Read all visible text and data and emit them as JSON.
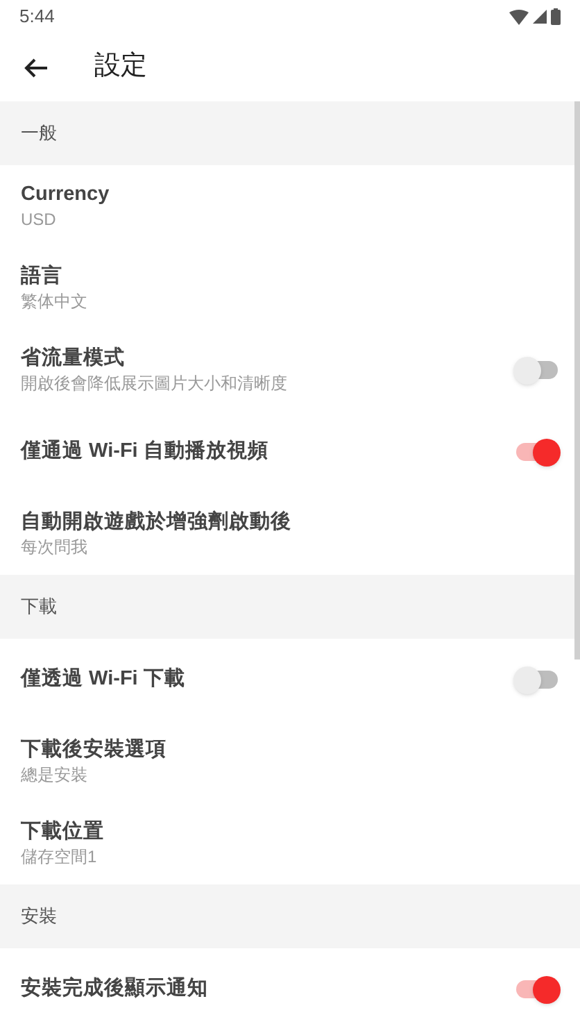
{
  "status_bar": {
    "time": "5:44"
  },
  "app_bar": {
    "title": "設定"
  },
  "sections": [
    {
      "header": "一般",
      "items": [
        {
          "kind": "text",
          "title": "Currency",
          "subtitle": "USD"
        },
        {
          "kind": "text",
          "title": "語言",
          "subtitle": "繁体中文"
        },
        {
          "kind": "toggle",
          "title": "省流量模式",
          "subtitle": "開啟後會降低展示圖片大小和清晰度",
          "on": false
        },
        {
          "kind": "toggle",
          "title": "僅通過 Wi-Fi 自動播放視頻",
          "on": true
        },
        {
          "kind": "text",
          "title": "自動開啟遊戲於增強劑啟動後",
          "subtitle": "每次問我"
        }
      ]
    },
    {
      "header": "下載",
      "items": [
        {
          "kind": "toggle",
          "title": "僅透過 Wi-Fi 下載",
          "on": false
        },
        {
          "kind": "text",
          "title": "下載後安裝選項",
          "subtitle": "總是安裝"
        },
        {
          "kind": "text",
          "title": "下載位置",
          "subtitle": "儲存空間1"
        }
      ]
    },
    {
      "header": "安裝",
      "items": [
        {
          "kind": "toggle",
          "title": "安裝完成後顯示通知",
          "on": true
        }
      ]
    }
  ]
}
